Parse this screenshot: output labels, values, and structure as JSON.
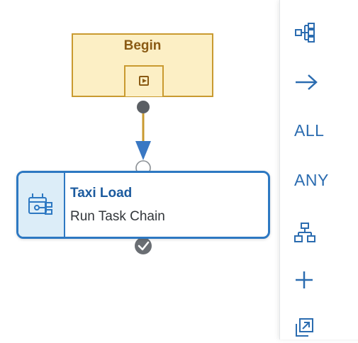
{
  "begin_node": {
    "label": "Begin",
    "play_icon": "play-icon"
  },
  "connector": {
    "icons": [
      "input-port-circle",
      "output-port-dot",
      "arrowhead-icon"
    ]
  },
  "task_node": {
    "title": "Taxi Load",
    "subtitle": "Run Task Chain",
    "icon": "task-chain-icon",
    "status_icon": "checkmark-icon"
  },
  "toolbar": {
    "items": [
      {
        "name": "tree-layout-icon",
        "label": ""
      },
      {
        "name": "arrow-right-icon",
        "label": ""
      },
      {
        "name": "all-operator",
        "label": "ALL"
      },
      {
        "name": "any-operator",
        "label": "ANY"
      },
      {
        "name": "hierarchy-icon",
        "label": ""
      },
      {
        "name": "add-icon",
        "label": ""
      },
      {
        "name": "open-external-icon",
        "label": ""
      }
    ]
  },
  "colors": {
    "begin_fill": "#fcefc5",
    "begin_border": "#c99a30",
    "begin_text": "#8a5a14",
    "task_border": "#2d78c2",
    "task_panel": "#dcedf8",
    "task_title": "#1b5a9e",
    "connector_gold": "#c99a30",
    "arrow_blue": "#3a78c3",
    "toolbar_icon": "#2b6cb0"
  }
}
